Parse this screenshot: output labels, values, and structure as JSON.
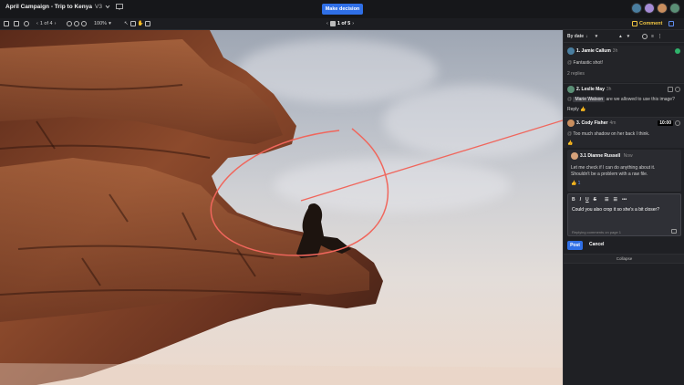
{
  "header": {
    "title": "April Campaign - Trip to Kenya",
    "version": "V3",
    "decision_button": "Make decision",
    "page_nav": "1 of 5"
  },
  "toolbar": {
    "page_indicator": "1 of 4",
    "zoom": "100%",
    "comment_label": "Comment"
  },
  "sidebar": {
    "sort_label": "By date",
    "comments": [
      {
        "number_name": "1. Jamie Callum",
        "time": "3h",
        "text": "Fantastic shot!",
        "replies": "2 replies",
        "resolved": true
      },
      {
        "number_name": "2. Leslie May",
        "time": "3h",
        "mention": "Marie Watson",
        "text": "are we allowed to use this image?",
        "reply_label": "Reply"
      },
      {
        "number_name": "3. Cody Fisher",
        "time": "4m",
        "timecode": "10:00",
        "text": "Too much shadow on her back I think."
      }
    ],
    "nested_reply": {
      "name": "3.1 Dianne Russell",
      "time": "Now",
      "text_line1": "Let me check if I can do anything about it.",
      "text_line2": "Shouldn't be a problem with a raw file.",
      "likes": "1"
    },
    "editor": {
      "text": "Could you also crop it so she's a bit closer?",
      "status": "Replying comments on page 1"
    },
    "post_label": "Post",
    "cancel_label": "Cancel",
    "collapse_label": "Collapse"
  },
  "colors": {
    "accent": "#2f6fe6",
    "annotation": "#f0665c",
    "resolved": "#2fb36b",
    "comment_button": "#f0c542"
  }
}
